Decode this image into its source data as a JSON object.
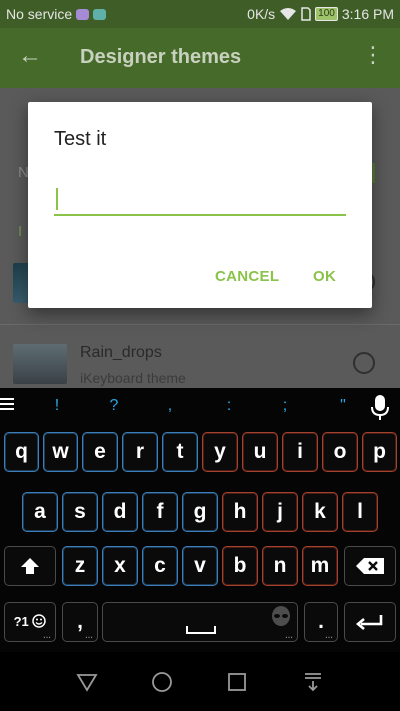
{
  "status_bar": {
    "carrier": "No service",
    "speed": "0K/s",
    "battery": "100",
    "time": "3:16 PM"
  },
  "app_bar": {
    "title": "Designer themes"
  },
  "background": {
    "frag_n": "N",
    "frag_i": "I",
    "theme_row": {
      "title": "Rain_drops",
      "subtitle": "iKeyboard theme"
    }
  },
  "dialog": {
    "title": "Test it",
    "input_value": "",
    "cancel_label": "CANCEL",
    "ok_label": "OK"
  },
  "keyboard": {
    "symbol_row": [
      "!",
      "?",
      ",",
      ":",
      ";",
      "\""
    ],
    "row1": [
      "q",
      "w",
      "e",
      "r",
      "t",
      "y",
      "u",
      "i",
      "o",
      "p"
    ],
    "row2": [
      "a",
      "s",
      "d",
      "f",
      "g",
      "h",
      "j",
      "k",
      "l"
    ],
    "row3": [
      "z",
      "x",
      "c",
      "v",
      "b",
      "n",
      "m"
    ],
    "symbols_key_label": "?1",
    "comma_key_label": ",",
    "period_key_label": "."
  },
  "colors": {
    "accent": "#8bc34a",
    "key_border_blue": "#3c7fb8",
    "key_border_red": "#a4412e",
    "symbol_blue": "#2aa7e8"
  },
  "icons": {
    "status": [
      "wifi-icon",
      "sim-icon",
      "battery-icon"
    ],
    "app_bar": [
      "back-arrow-icon",
      "overflow-menu-icon"
    ],
    "keyboard": [
      "menu-icon",
      "mic-icon",
      "shift-icon",
      "backspace-icon",
      "emoji-icon",
      "alien-icon",
      "enter-icon"
    ],
    "nav": [
      "back-triangle-icon",
      "home-circle-icon",
      "recents-square-icon",
      "keyboard-hide-icon"
    ]
  }
}
